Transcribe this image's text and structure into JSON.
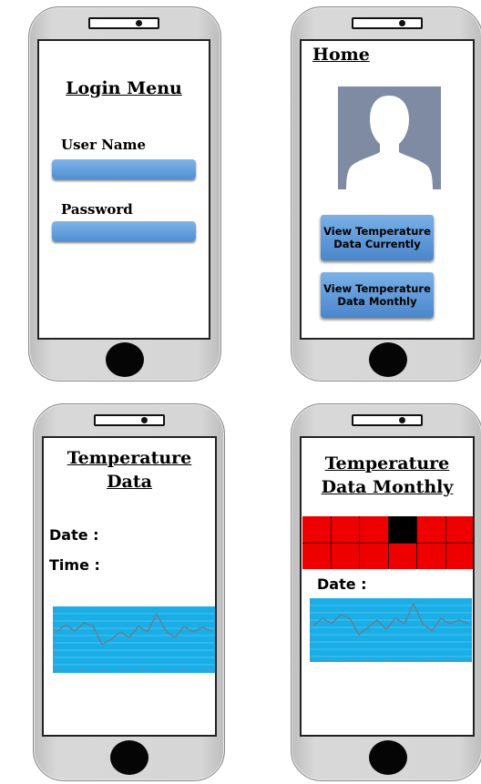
{
  "screens": {
    "login": {
      "title": "Login Menu",
      "username_label": "User Name",
      "password_label": "Password"
    },
    "home": {
      "title": "Home",
      "btn_current": "View Temperature Data Currently",
      "btn_monthly": "View Temperature Data Monthly"
    },
    "temp": {
      "title_line1": "Temperature",
      "title_line2": "Data",
      "date_label": "Date  :",
      "time_label": "Time  :"
    },
    "monthly": {
      "title_line1": "Temperature",
      "title_line2": "Data Monthly",
      "date_label": "Date  :"
    }
  },
  "colors": {
    "chart_bg": "#19aee8",
    "calendar_red": "#ee0000",
    "button_blue": "#5f9ad8"
  },
  "icons": [
    "avatar-silhouette-icon"
  ]
}
